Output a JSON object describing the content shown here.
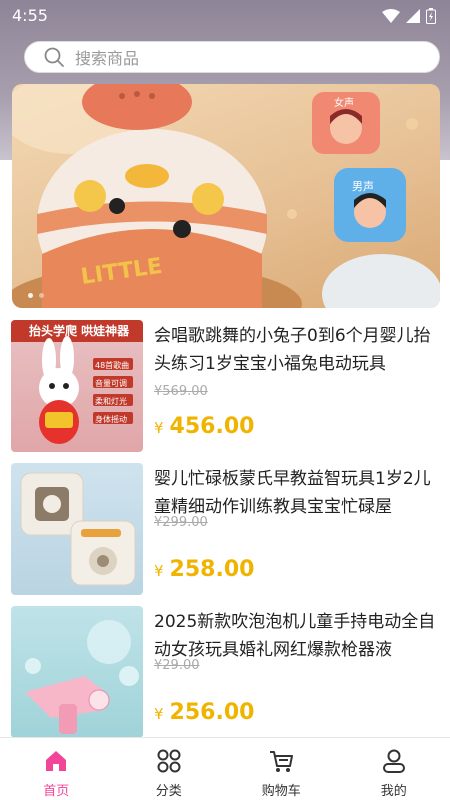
{
  "status_bar": {
    "time": "4:55",
    "icons": [
      "wifi-icon",
      "signal-icon",
      "battery-icon"
    ]
  },
  "search": {
    "placeholder": "搜索商品",
    "icon": "search-icon"
  },
  "banner": {
    "slide_count": 2,
    "active_slide": 1
  },
  "products": [
    {
      "title": "会唱歌跳舞的小兔子0到6个月婴儿抬头练习1岁宝宝小福兔电动玩具",
      "original_price": "569.00",
      "price": "456.00",
      "thumb_labels": [
        "抬头学爬 哄娃神器",
        "48首歌曲",
        "音量可调",
        "柔和灯光",
        "身体摇动"
      ]
    },
    {
      "title": "婴儿忙碌板蒙氏早教益智玩具1岁2儿童精细动作训练教具宝宝忙碌屋",
      "original_price": "299.00",
      "price": "258.00"
    },
    {
      "title": "2025新款吹泡泡机儿童手持电动全自动女孩玩具婚礼网红爆款枪器液",
      "original_price": "29.00",
      "price": "256.00"
    }
  ],
  "currency_symbol": "¥",
  "tabbar": [
    {
      "label": "首页",
      "icon": "home-icon",
      "active": true
    },
    {
      "label": "分类",
      "icon": "category-icon",
      "active": false
    },
    {
      "label": "购物车",
      "icon": "cart-icon",
      "active": false
    },
    {
      "label": "我的",
      "icon": "profile-icon",
      "active": false
    }
  ],
  "colors": {
    "accent": "#f2459a",
    "price": "#f0b400",
    "header": "#8e8497"
  }
}
